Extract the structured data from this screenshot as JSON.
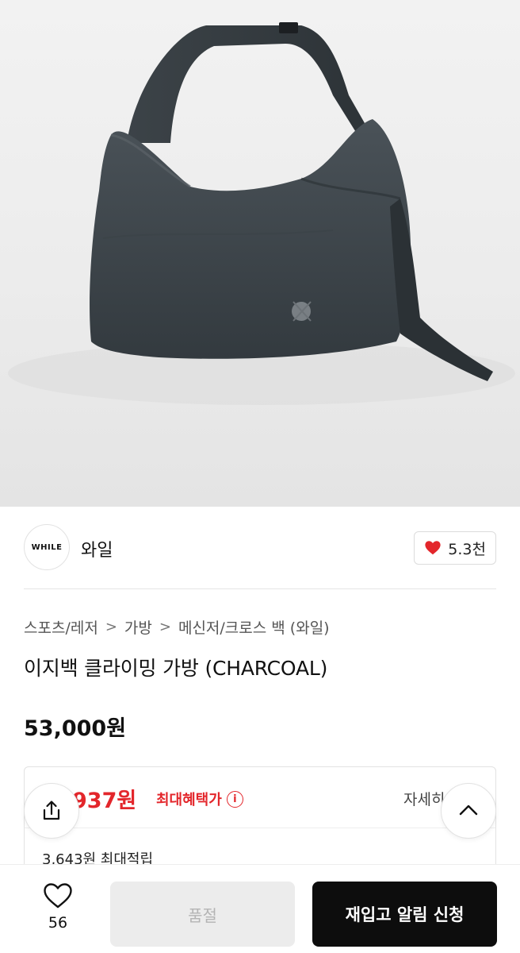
{
  "product": {
    "image_alt": "charcoal crossbody bag",
    "brand_logo_text": "WHILE",
    "brand_name": "와일",
    "like_count": "5.3천",
    "breadcrumb": [
      "스포츠/레저",
      "가방",
      "메신저/크로스 백 (와일)"
    ],
    "breadcrumb_separator": ">",
    "title": "이지백 클라이밍 가방 (CHARCOAL)",
    "price": "53,000원"
  },
  "benefit": {
    "price": "937원",
    "label": "최대혜택가",
    "info_icon": "i",
    "detail": "자세히",
    "points": "3,643원 최대적립"
  },
  "bottom_bar": {
    "wish_count": "56",
    "soldout_label": "품절",
    "restock_label": "재입고 알림 신청"
  },
  "colors": {
    "accent_red": "#e3262b",
    "primary_black": "#0d0d0d",
    "disabled_gray": "#ececec"
  },
  "icons": [
    "heart-icon",
    "info-icon",
    "share-icon",
    "chevron-up-icon",
    "heart-outline-icon"
  ]
}
